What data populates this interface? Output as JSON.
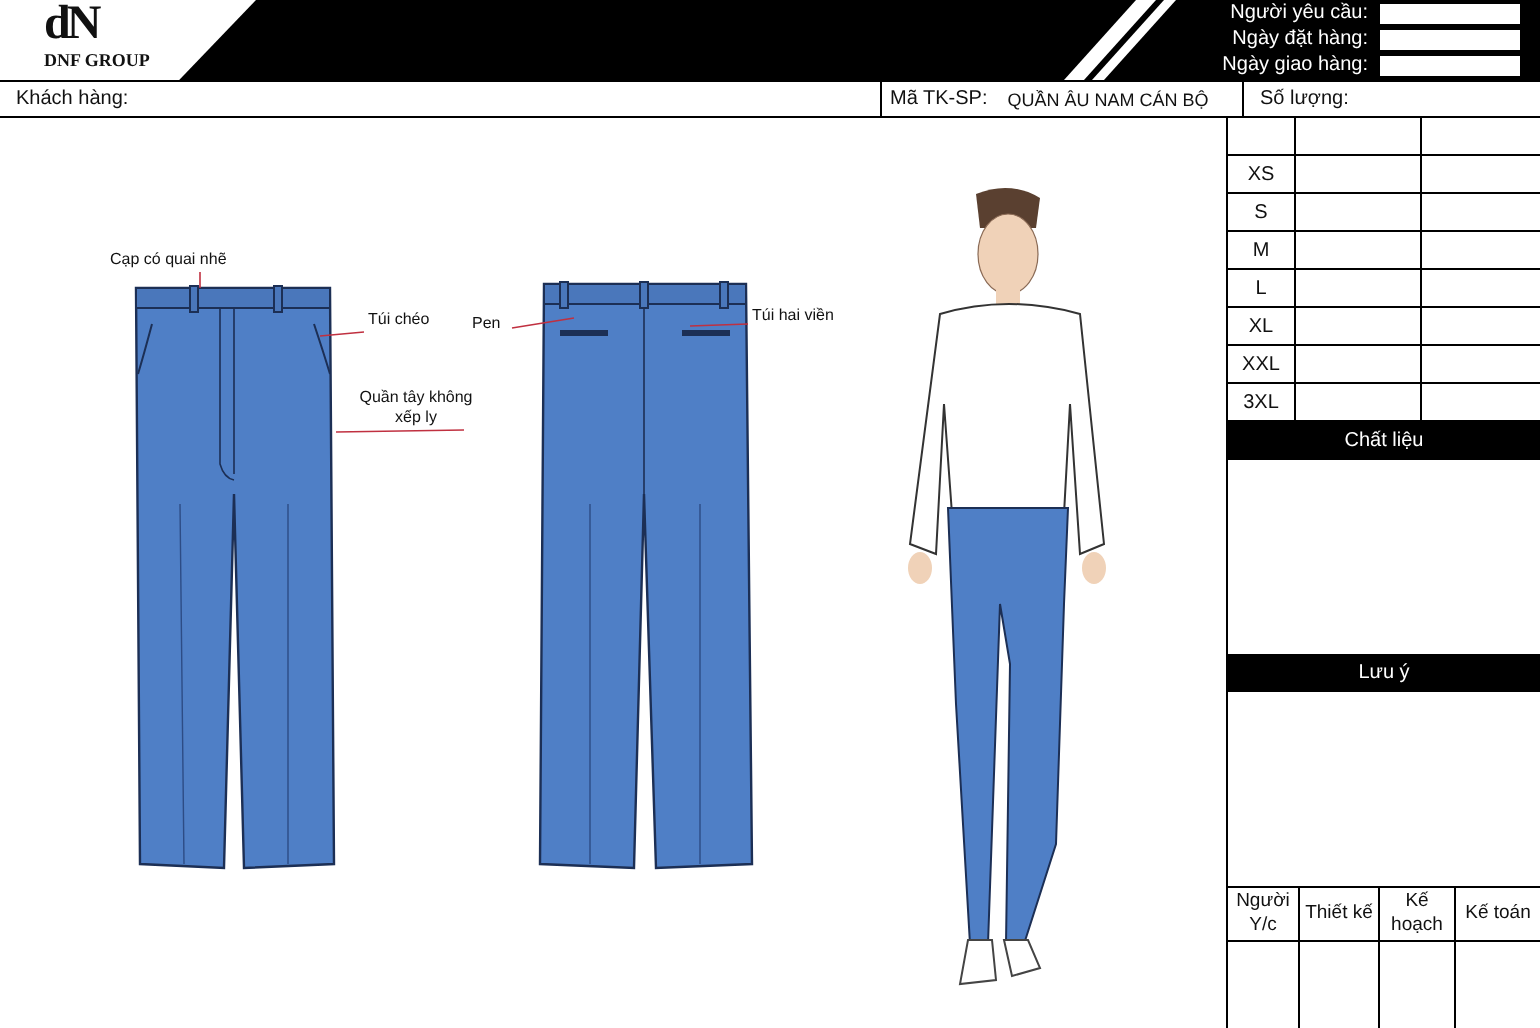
{
  "header": {
    "logo_mark": "dN",
    "logo_text": "DNF GROUP",
    "fields": [
      {
        "label": "Người yêu cầu:"
      },
      {
        "label": "Ngày đặt hàng:"
      },
      {
        "label": "Ngày giao hàng:"
      }
    ]
  },
  "info_bar": {
    "customer_label": "Khách hàng:",
    "code_label": "Mã TK-SP:",
    "code_value": "QUẦN ÂU NAM CÁN BỘ",
    "quantity_label": "Số lượng:"
  },
  "sketches": {
    "front_callouts": [
      {
        "text": "Cạp có quai nhẽ"
      },
      {
        "text": "Túi chéo"
      },
      {
        "text": "Quần tây không xếp ly"
      }
    ],
    "back_callouts": [
      {
        "text": "Pen"
      },
      {
        "text": "Túi hai viền"
      }
    ]
  },
  "sizes": [
    "XS",
    "S",
    "M",
    "L",
    "XL",
    "XXL",
    "3XL"
  ],
  "material": {
    "title": "Chất liệu"
  },
  "notes": {
    "title": "Lưu ý"
  },
  "approvals": [
    "Người Y/c",
    "Thiết kế",
    "Kế hoạch",
    "Kế toán"
  ]
}
